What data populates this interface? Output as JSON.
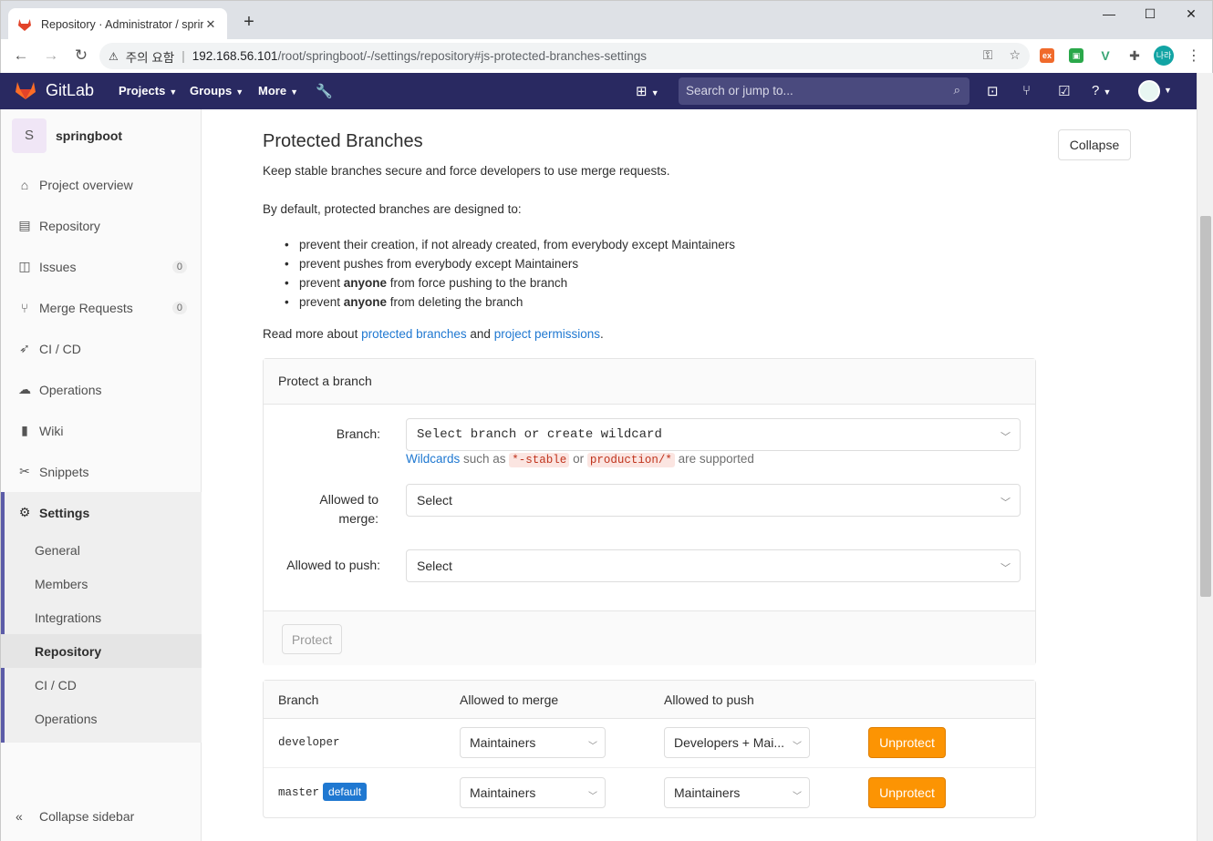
{
  "browser": {
    "tab_title": "Repository · Administrator / springboot",
    "security_label": "주의 요함",
    "url_host": "192.168.56.101",
    "url_path": "/root/springboot/-/settings/repository#js-protected-branches-settings",
    "profile_initials": "나라"
  },
  "header": {
    "brand": "GitLab",
    "nav": [
      "Projects",
      "Groups",
      "More"
    ],
    "search_placeholder": "Search or jump to..."
  },
  "sidebar": {
    "project_initial": "S",
    "project_name": "springboot",
    "items": [
      {
        "label": "Project overview",
        "icon": "home-icon"
      },
      {
        "label": "Repository",
        "icon": "doc-icon"
      },
      {
        "label": "Issues",
        "icon": "issues-icon",
        "count": "0"
      },
      {
        "label": "Merge Requests",
        "icon": "merge-request-icon",
        "count": "0"
      },
      {
        "label": "CI / CD",
        "icon": "rocket-icon"
      },
      {
        "label": "Operations",
        "icon": "cloud-icon"
      },
      {
        "label": "Wiki",
        "icon": "book-icon"
      },
      {
        "label": "Snippets",
        "icon": "scissors-icon"
      },
      {
        "label": "Settings",
        "icon": "gear-icon"
      }
    ],
    "settings_sub": [
      "General",
      "Members",
      "Integrations",
      "Repository",
      "CI / CD",
      "Operations"
    ],
    "collapse_label": "Collapse sidebar"
  },
  "section": {
    "title": "Protected Branches",
    "collapse_button": "Collapse",
    "intro": "Keep stable branches secure and force developers to use merge requests.",
    "default_intro": "By default, protected branches are designed to:",
    "bullets": [
      {
        "pre": "prevent their creation, if not already created, from everybody except Maintainers",
        "bold": "",
        "post": ""
      },
      {
        "pre": "prevent pushes from everybody except Maintainers",
        "bold": "",
        "post": ""
      },
      {
        "pre": "prevent ",
        "bold": "anyone",
        "post": " from force pushing to the branch"
      },
      {
        "pre": "prevent ",
        "bold": "anyone",
        "post": " from deleting the branch"
      }
    ],
    "read_more_pre": "Read more about ",
    "link_protected": "protected branches",
    "read_more_and": " and ",
    "link_permissions": "project permissions",
    "read_more_post": "."
  },
  "form": {
    "heading": "Protect a branch",
    "branch_label": "Branch:",
    "branch_value": "Select branch or create wildcard",
    "hint_link": "Wildcards",
    "hint_such": " such as ",
    "hint_code1": "*-stable",
    "hint_or": " or ",
    "hint_code2": "production/*",
    "hint_post": " are supported",
    "merge_label": "Allowed to merge:",
    "merge_value": "Select",
    "push_label": "Allowed to push:",
    "push_value": "Select",
    "protect_button": "Protect"
  },
  "table": {
    "headers": [
      "Branch",
      "Allowed to merge",
      "Allowed to push"
    ],
    "rows": [
      {
        "branch": "developer",
        "badge": "",
        "merge": "Maintainers",
        "push": "Developers + Mai...",
        "action": "Unprotect"
      },
      {
        "branch": "master",
        "badge": "default",
        "merge": "Maintainers",
        "push": "Maintainers",
        "action": "Unprotect"
      }
    ]
  },
  "colors": {
    "header_bg": "#292961",
    "link": "#1f78d1",
    "unprotect": "#fc9403",
    "settings_accent": "#5c5ca8"
  }
}
